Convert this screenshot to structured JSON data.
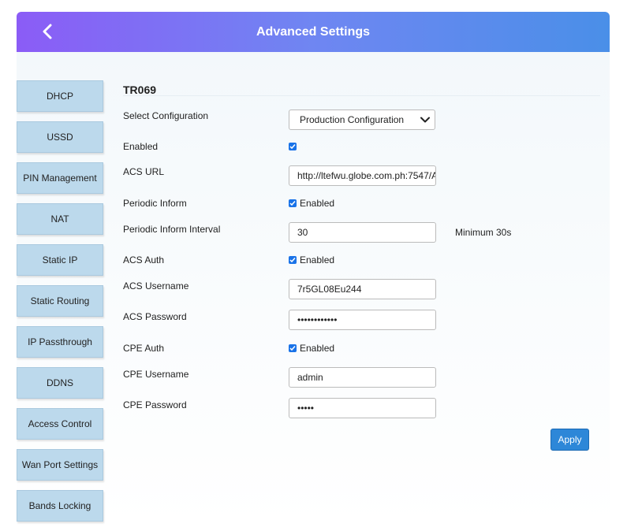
{
  "header": {
    "title": "Advanced Settings"
  },
  "sidebar": {
    "items": [
      "DHCP",
      "USSD",
      "PIN Management",
      "NAT",
      "Static IP",
      "Static Routing",
      "IP Passthrough",
      "DDNS",
      "Access Control",
      "Wan Port Settings",
      "Bands Locking"
    ]
  },
  "form": {
    "section_title": "TR069",
    "select_configuration": {
      "label": "Select Configuration",
      "value": "Production Configuration"
    },
    "enabled": {
      "label": "Enabled",
      "checked": true
    },
    "acs_url": {
      "label": "ACS URL",
      "value": "http://ltefwu.globe.com.ph:7547/A"
    },
    "periodic_inform": {
      "label": "Periodic Inform",
      "checkbox_label": "Enabled",
      "checked": true
    },
    "periodic_inform_interval": {
      "label": "Periodic Inform Interval",
      "value": "30",
      "hint": "Minimum 30s"
    },
    "acs_auth": {
      "label": "ACS Auth",
      "checkbox_label": "Enabled",
      "checked": true
    },
    "acs_username": {
      "label": "ACS Username",
      "value": "7r5GL08Eu244"
    },
    "acs_password": {
      "label": "ACS Password",
      "value": "••••••••••••"
    },
    "cpe_auth": {
      "label": "CPE Auth",
      "checkbox_label": "Enabled",
      "checked": true
    },
    "cpe_username": {
      "label": "CPE Username",
      "value": "admin"
    },
    "cpe_password": {
      "label": "CPE Password",
      "value": "•••••"
    },
    "apply_label": "Apply"
  },
  "colors": {
    "header_gradient_start": "#8b5cf6",
    "header_gradient_end": "#4a8fe8",
    "sidebar_item_bg": "#bcd9ec",
    "checkbox_accent": "#1a73e8",
    "apply_button_bg": "#2d87d8"
  },
  "icons": {
    "back": "chevron-left-icon",
    "select_arrow": "chevron-down-icon",
    "checkbox": "checkmark-icon"
  }
}
